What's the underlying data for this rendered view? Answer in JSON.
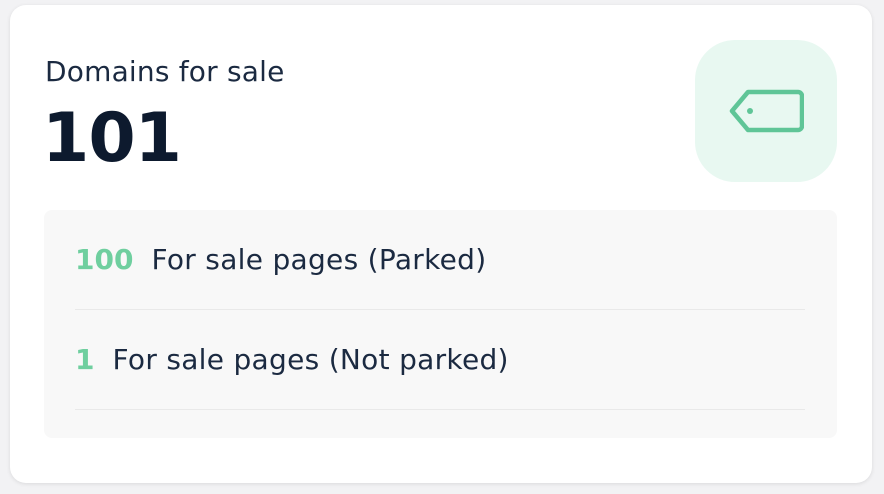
{
  "card": {
    "title": "Domains for sale",
    "total": "101",
    "icon": "price-tag-icon",
    "icon_color": "#5fc597",
    "icon_bg": "#e8f8f1"
  },
  "breakdown": [
    {
      "count": "100",
      "label": "For sale pages (Parked)"
    },
    {
      "count": "1",
      "label": "For sale pages (Not parked)"
    }
  ],
  "colors": {
    "accent": "#6fcf9f",
    "text": "#1b2a41"
  }
}
